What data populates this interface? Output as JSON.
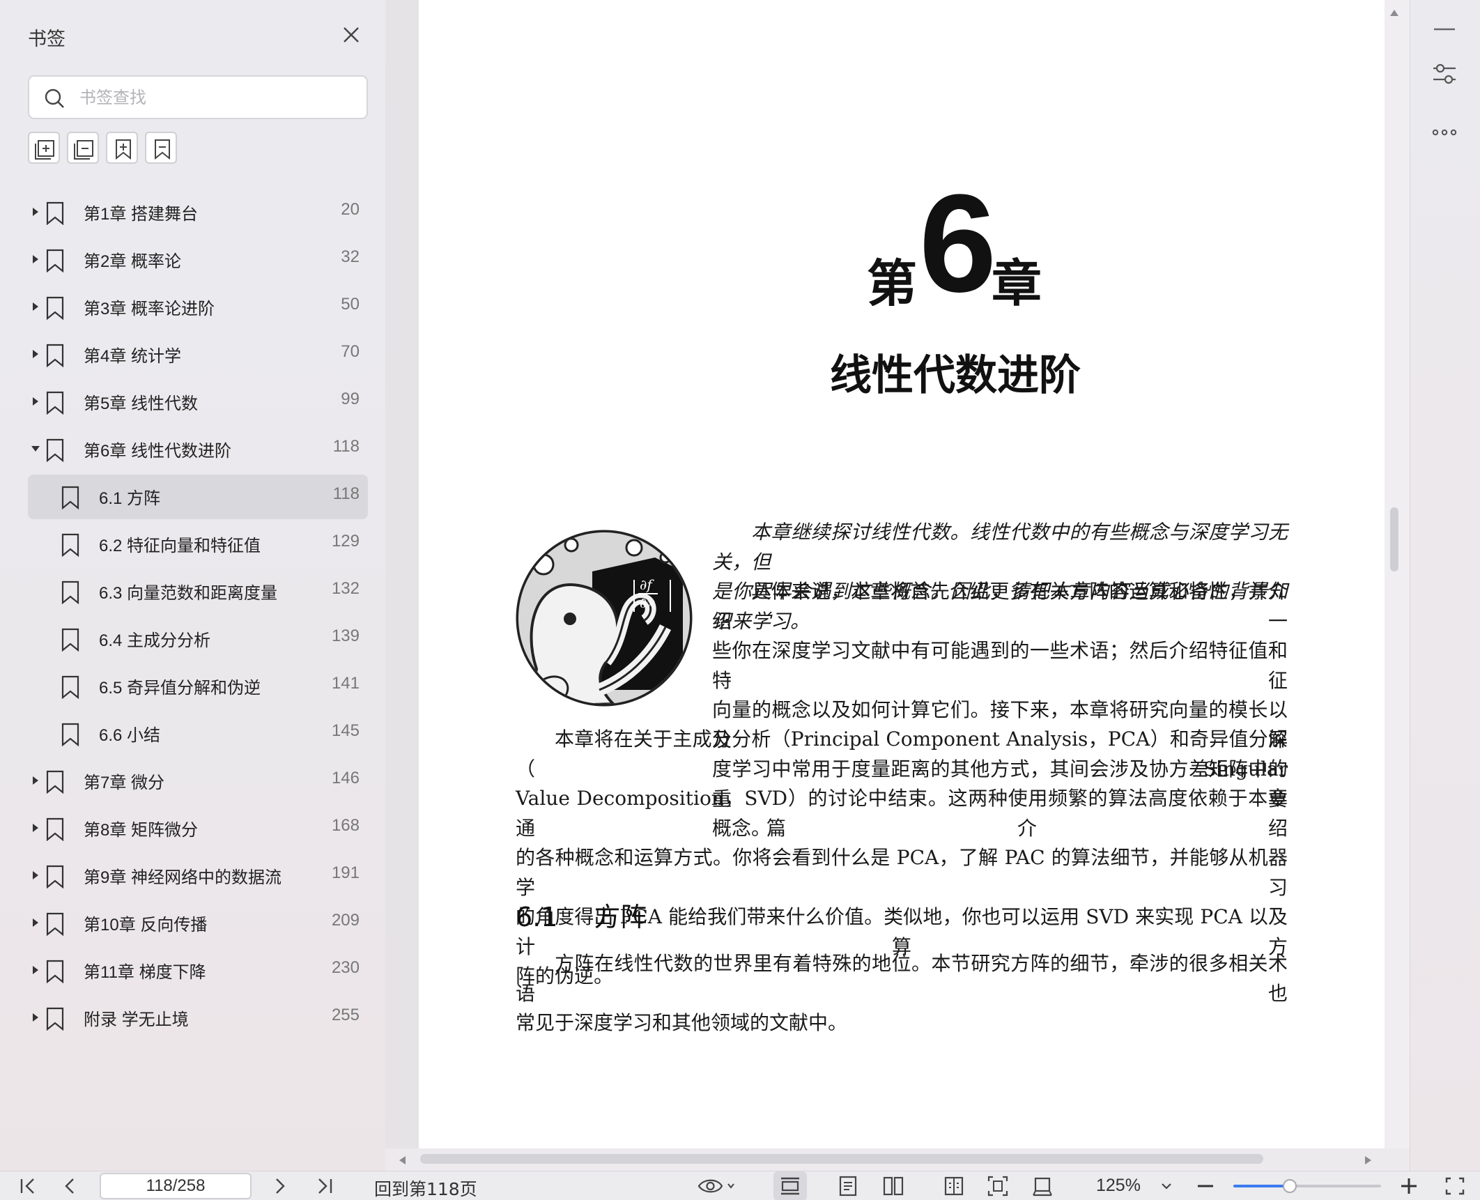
{
  "sidebar": {
    "title": "书签",
    "search_placeholder": "书签查找",
    "items": [
      {
        "label": "第1章 搭建舞台",
        "page": "20",
        "level": 0,
        "state": "collapsed"
      },
      {
        "label": "第2章 概率论",
        "page": "32",
        "level": 0,
        "state": "collapsed"
      },
      {
        "label": "第3章 概率论进阶",
        "page": "50",
        "level": 0,
        "state": "collapsed"
      },
      {
        "label": "第4章 统计学",
        "page": "70",
        "level": 0,
        "state": "collapsed"
      },
      {
        "label": "第5章 线性代数",
        "page": "99",
        "level": 0,
        "state": "collapsed"
      },
      {
        "label": "第6章 线性代数进阶",
        "page": "118",
        "level": 0,
        "state": "expanded"
      },
      {
        "label": "6.1 方阵",
        "page": "118",
        "level": 1,
        "state": "selected"
      },
      {
        "label": "6.2 特征向量和特征值",
        "page": "129",
        "level": 1,
        "state": ""
      },
      {
        "label": "6.3 向量范数和距离度量",
        "page": "132",
        "level": 1,
        "state": ""
      },
      {
        "label": "6.4 主成分分析",
        "page": "139",
        "level": 1,
        "state": ""
      },
      {
        "label": "6.5 奇异值分解和伪逆",
        "page": "141",
        "level": 1,
        "state": ""
      },
      {
        "label": "6.6 小结",
        "page": "145",
        "level": 1,
        "state": ""
      },
      {
        "label": "第7章 微分",
        "page": "146",
        "level": 0,
        "state": "collapsed"
      },
      {
        "label": "第8章 矩阵微分",
        "page": "168",
        "level": 0,
        "state": "collapsed"
      },
      {
        "label": "第9章 神经网络中的数据流",
        "page": "191",
        "level": 0,
        "state": "collapsed"
      },
      {
        "label": "第10章 反向传播",
        "page": "209",
        "level": 0,
        "state": "collapsed"
      },
      {
        "label": "第11章 梯度下降",
        "page": "230",
        "level": 0,
        "state": "collapsed"
      },
      {
        "label": "附录 学无止境",
        "page": "255",
        "level": 0,
        "state": "collapsed"
      }
    ]
  },
  "document": {
    "chapter_prefix": "第",
    "chapter_number": "6",
    "chapter_suffix": "章",
    "chapter_title": "线性代数进阶",
    "intro_italic_line1": "本章继续探讨线性代数。线性代数中的有些概念与深度学习无关，但",
    "intro_italic_line2": "是你迟早会遇到这些概念。因此，请把本章内容当成必备的背景知识来学习。",
    "para1_lines": [
      "具体来说，本章将首先介绍更多有关方阵的运算和特性，并介绍一",
      "些你在深度学习文献中有可能遇到的一些术语；然后介绍特征值和特征",
      "向量的概念以及如何计算它们。接下来，本章将研究向量的模长以及深",
      "度学习中常用于度量距离的其他方式，其间会涉及协方差矩阵中的重要",
      "概念。"
    ],
    "para2_lines": [
      "本章将在关于主成分分析（Principal Component Analysis，PCA）和奇异值分解（Singular",
      "Value Decomposition，SVD）的讨论中结束。这两种使用频繁的算法高度依赖于本章通篇介绍",
      "的各种概念和运算方式。你将会看到什么是 PCA，了解 PAC 的算法细节，并能够从机器学习",
      "的角度得出 PCA 能给我们带来什么价值。类似地，你也可以运用 SVD 来实现 PCA 以及计算方",
      "阵的伪逆。"
    ],
    "section_number": "6.1",
    "section_title": "方阵",
    "para3_lines": [
      "方阵在线性代数的世界里有着特殊的地位。本节研究方阵的细节，牵涉的很多相关术语也",
      "常见于深度学习和其他领域的文献中。"
    ]
  },
  "bottombar": {
    "page_value": "118/258",
    "goto_label": "回到第118页",
    "zoom_label": "125%",
    "zoom_fraction": 0.38
  },
  "colors": {
    "accent": "#3a7bf0",
    "selected_row": "#d9d8dd"
  }
}
